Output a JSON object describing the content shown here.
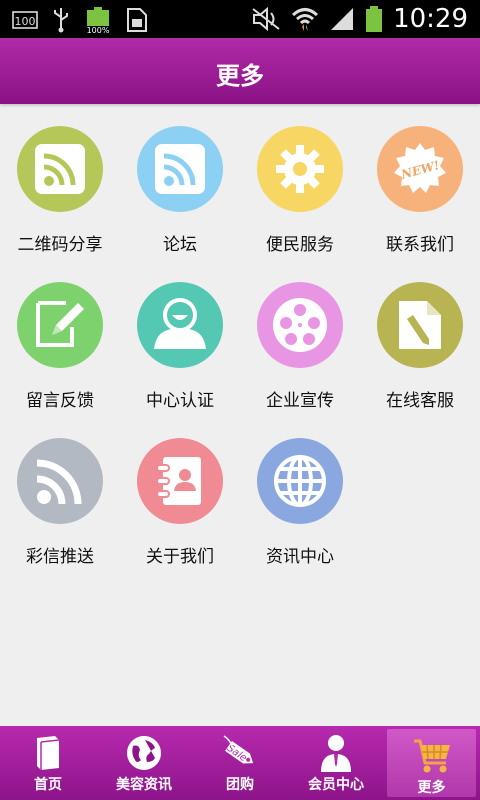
{
  "status_bar": {
    "left_icons": [
      "sim-100-icon",
      "usb-icon",
      "battery-charging-icon",
      "sim-card-icon"
    ],
    "battery_small_text": "100%",
    "sim_text": "100",
    "time": "10:29"
  },
  "header": {
    "title": "更多"
  },
  "grid": [
    {
      "label": "二维码分享",
      "icon": "rss-icon",
      "color": "#b6c75a"
    },
    {
      "label": "论坛",
      "icon": "rss-icon",
      "color": "#8cd0f3"
    },
    {
      "label": "便民服务",
      "icon": "gear-icon",
      "color": "#f8d663"
    },
    {
      "label": "联系我们",
      "icon": "new-badge-icon",
      "color": "#f6b27a"
    },
    {
      "label": "留言反馈",
      "icon": "edit-icon",
      "color": "#7ed26d"
    },
    {
      "label": "中心认证",
      "icon": "user-icon",
      "color": "#55c8b4"
    },
    {
      "label": "企业宣传",
      "icon": "film-reel-icon",
      "color": "#e896e4"
    },
    {
      "label": "在线客服",
      "icon": "document-edit-icon",
      "color": "#b8b452"
    },
    {
      "label": "彩信推送",
      "icon": "rss-icon",
      "color": "#b3b9c2"
    },
    {
      "label": "关于我们",
      "icon": "contact-book-icon",
      "color": "#f08b93"
    },
    {
      "label": "资讯中心",
      "icon": "globe-icon",
      "color": "#8aa8df"
    }
  ],
  "tabs": [
    {
      "label": "首页",
      "icon": "book-icon"
    },
    {
      "label": "美容资讯",
      "icon": "globe-icon"
    },
    {
      "label": "团购",
      "icon": "sale-tag-icon",
      "icon_text": "Sale"
    },
    {
      "label": "会员中心",
      "icon": "member-icon"
    },
    {
      "label": "更多",
      "icon": "cart-icon"
    }
  ],
  "tab_active": "更多"
}
